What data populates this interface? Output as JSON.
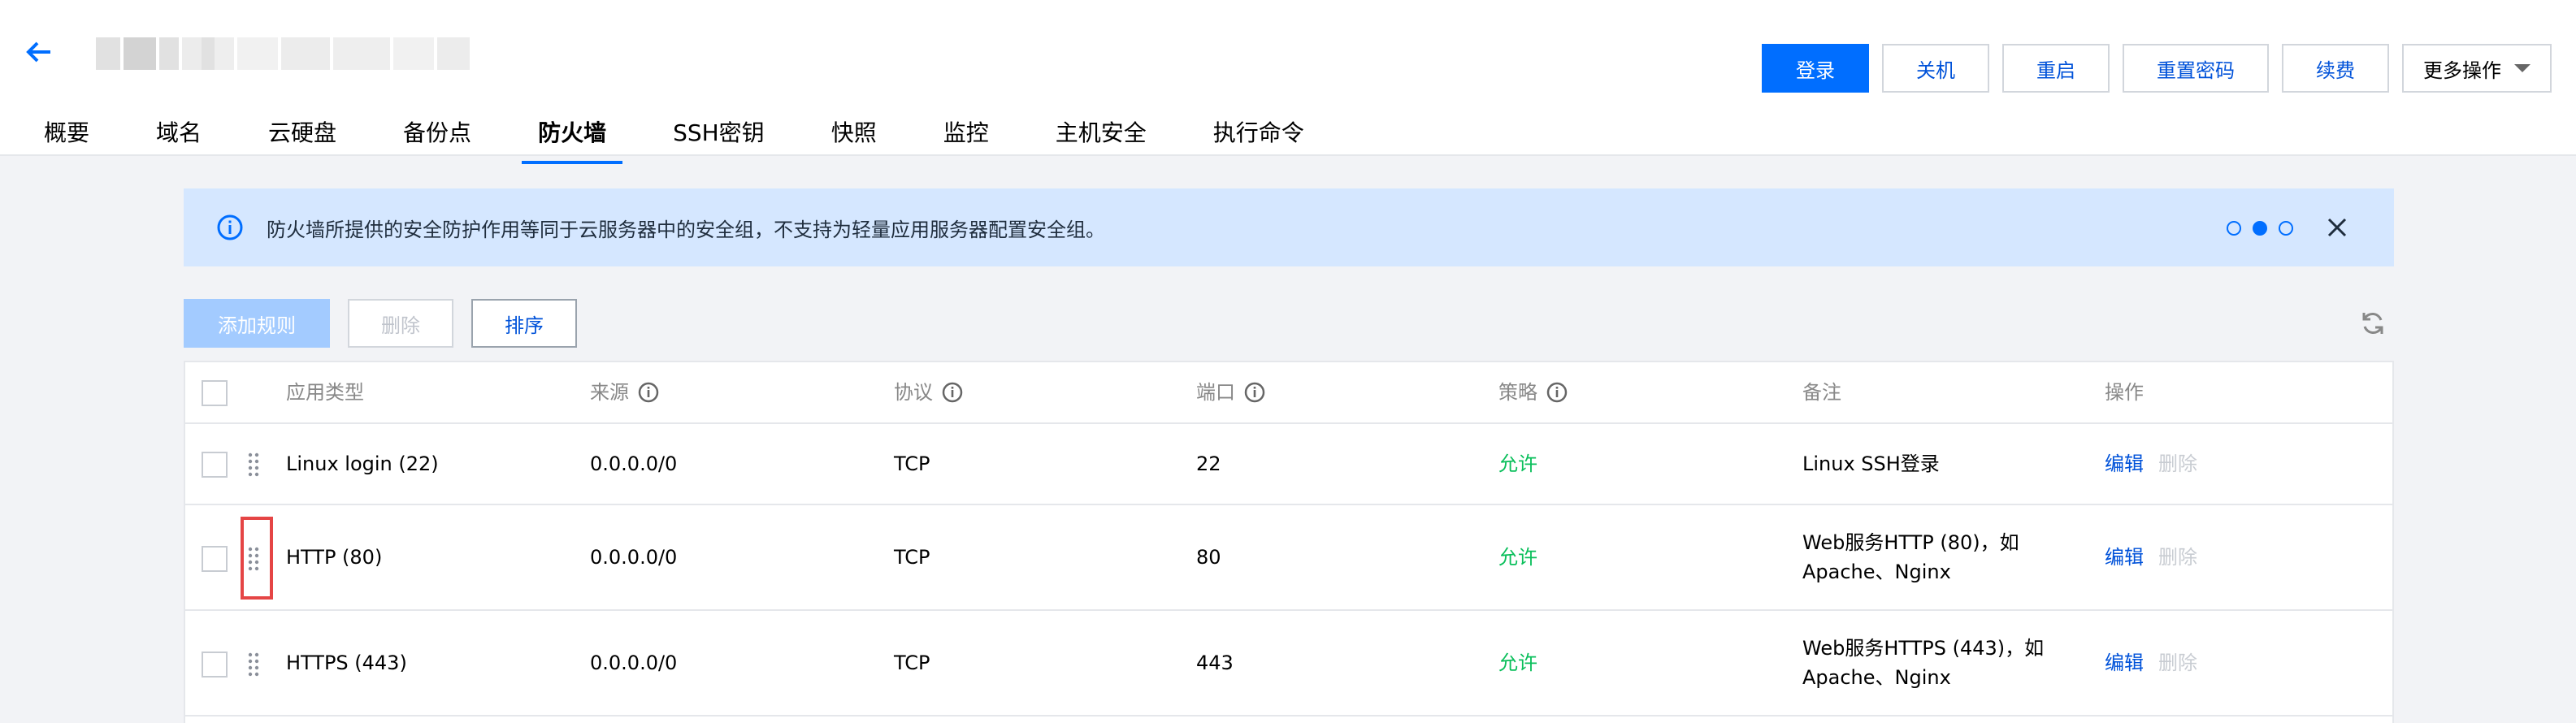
{
  "header": {
    "actions": [
      {
        "label": "登录",
        "primary": true
      },
      {
        "label": "关机"
      },
      {
        "label": "重启"
      },
      {
        "label": "重置密码"
      },
      {
        "label": "续费"
      }
    ],
    "more_label": "更多操作"
  },
  "tabs": [
    "概要",
    "域名",
    "云硬盘",
    "备份点",
    "防火墙",
    "SSH密钥",
    "快照",
    "监控",
    "主机安全",
    "执行命令"
  ],
  "active_tab": "防火墙",
  "notice": {
    "text": "防火墙所提供的安全防护作用等同于云服务器中的安全组，不支持为轻量应用服务器配置安全组。"
  },
  "toolbar": {
    "add_label": "添加规则",
    "delete_label": "删除",
    "sort_label": "排序"
  },
  "table": {
    "headers": {
      "app_type": "应用类型",
      "source": "来源",
      "protocol": "协议",
      "port": "端口",
      "policy": "策略",
      "remark": "备注",
      "ops": "操作"
    },
    "rows": [
      {
        "app_type": "Linux login (22)",
        "source": "0.0.0.0/0",
        "protocol": "TCP",
        "port": "22",
        "policy": "允许",
        "remark_l1": "Linux SSH登录",
        "remark_l2": "",
        "edit": "编辑",
        "remove": "删除"
      },
      {
        "app_type": "HTTP (80)",
        "source": "0.0.0.0/0",
        "protocol": "TCP",
        "port": "80",
        "policy": "允许",
        "remark_l1": "Web服务HTTP (80)，如",
        "remark_l2": "Apache、Nginx",
        "edit": "编辑",
        "remove": "删除"
      },
      {
        "app_type": "HTTPS (443)",
        "source": "0.0.0.0/0",
        "protocol": "TCP",
        "port": "443",
        "policy": "允许",
        "remark_l1": "Web服务HTTPS (443)，如",
        "remark_l2": "Apache、Nginx",
        "edit": "编辑",
        "remove": "删除"
      }
    ]
  },
  "colors": {
    "primary": "#006eff",
    "allow": "#0abf5b",
    "notice_bg": "#d5e7ff",
    "highlight": "#e54545"
  },
  "icons": [
    "arrow-left-icon",
    "info-icon",
    "close-icon",
    "refresh-icon",
    "question-icon",
    "drag-handle-icon",
    "chevron-down-icon"
  ]
}
